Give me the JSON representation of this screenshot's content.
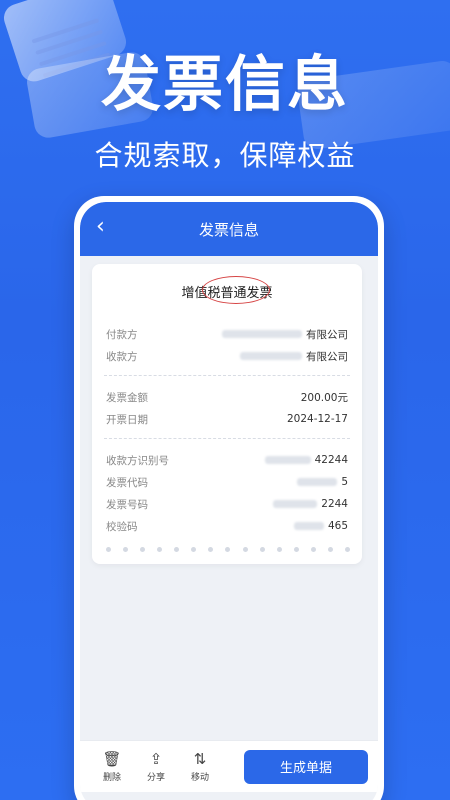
{
  "banner": {
    "headline": "发票信息",
    "subline": "合规索取，保障权益"
  },
  "nav": {
    "back_glyph": "‹",
    "title": "发票信息"
  },
  "invoice": {
    "title": "增值税普通发票",
    "payer_label": "付款方",
    "payer_value": "有限公司",
    "payee_label": "收款方",
    "payee_value": "有限公司",
    "amount_label": "发票金额",
    "amount_value": "200.00元",
    "date_label": "开票日期",
    "date_value": "2024-12-17",
    "taxid_label": "收款方识别号",
    "taxid_value": "42244",
    "code_label": "发票代码",
    "code_value": "5",
    "number_label": "发票号码",
    "number_value": "2244",
    "check_label": "校验码",
    "check_value": "465"
  },
  "toolbar": {
    "delete_label": "删除",
    "share_label": "分享",
    "move_label": "移动",
    "generate_label": "生成单据"
  },
  "colors": {
    "primary": "#2b68e8",
    "stamp": "#d64545"
  },
  "icons": {
    "delete": "trash-icon",
    "share": "share-icon",
    "move": "move-icon"
  }
}
